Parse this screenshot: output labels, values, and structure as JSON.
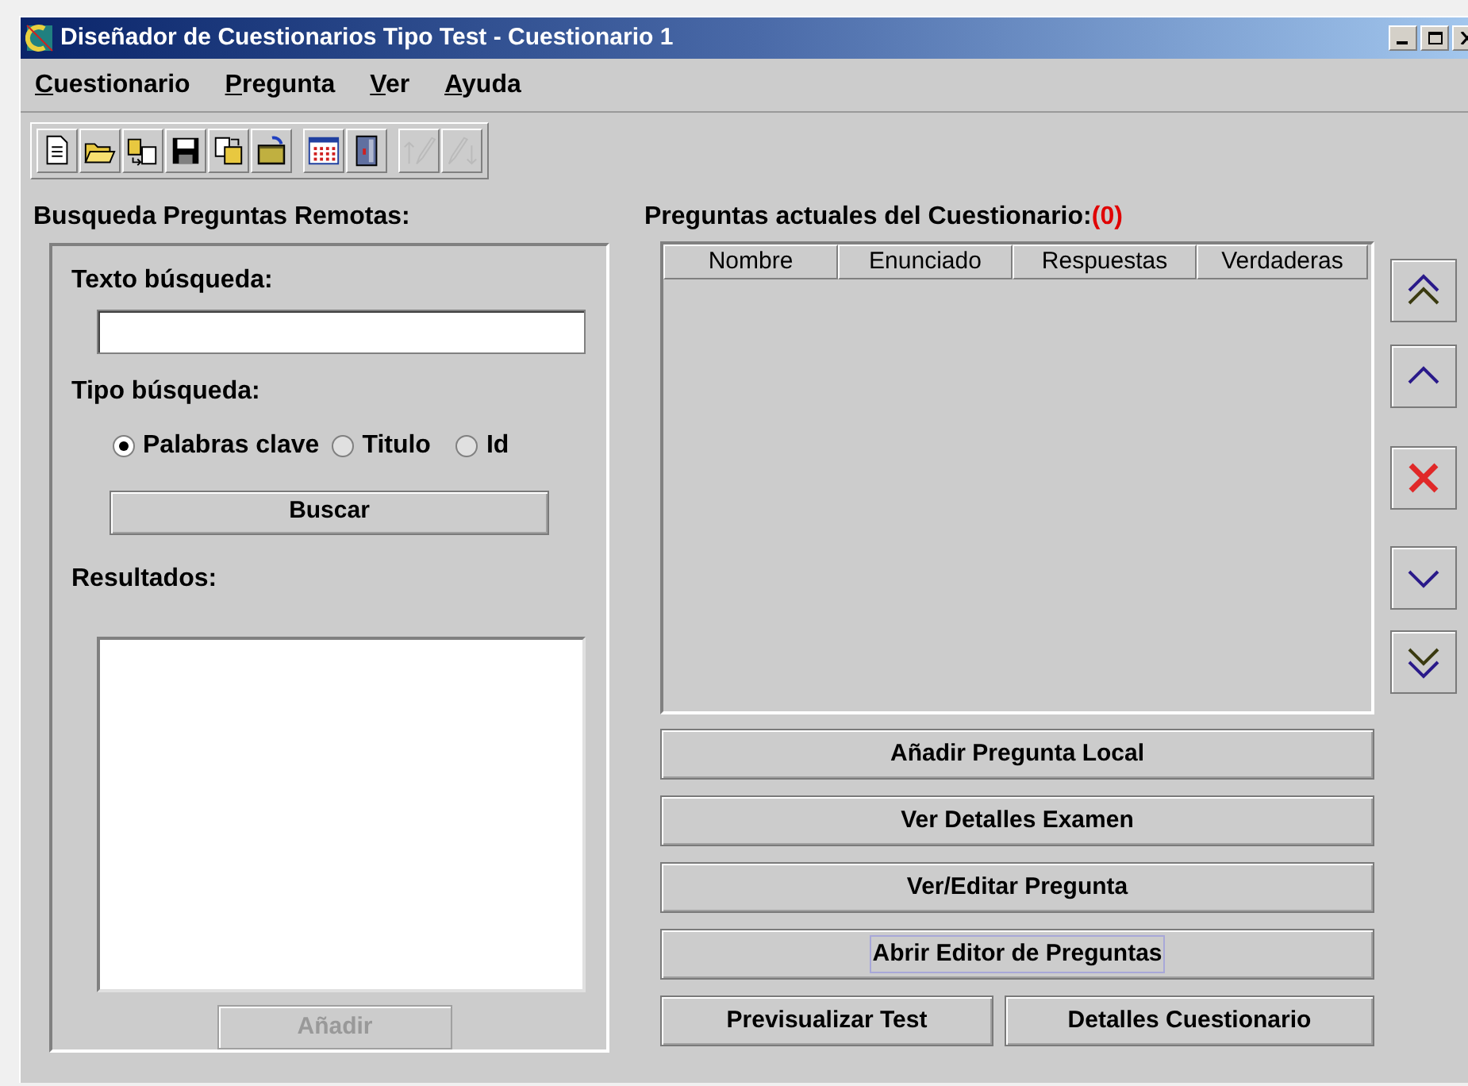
{
  "window": {
    "title": "Diseñador de Cuestionarios Tipo Test - Cuestionario 1"
  },
  "menu": [
    {
      "label": "Cuestionario"
    },
    {
      "label": "Pregunta"
    },
    {
      "label": "Ver"
    },
    {
      "label": "Ayuda"
    }
  ],
  "toolbar": [
    {
      "kind": "new",
      "disabled": false
    },
    {
      "kind": "open",
      "disabled": false
    },
    {
      "kind": "import",
      "disabled": false
    },
    {
      "kind": "save",
      "disabled": false
    },
    {
      "kind": "export",
      "disabled": false
    },
    {
      "kind": "folder",
      "disabled": false
    },
    {
      "kind": "calendar",
      "disabled": false
    },
    {
      "kind": "cabinet",
      "disabled": false
    },
    {
      "kind": "upload",
      "disabled": true
    },
    {
      "kind": "download",
      "disabled": true
    }
  ],
  "remote_search": {
    "title": "Busqueda Preguntas Remotas:",
    "text_label": "Texto búsqueda:",
    "type_label": "Tipo búsqueda:",
    "options": [
      {
        "label": "Palabras clave",
        "selected": true
      },
      {
        "label": "Titulo",
        "selected": false
      },
      {
        "label": "Id",
        "selected": false
      }
    ],
    "search_button": "Buscar",
    "results_label": "Resultados:",
    "add_button": {
      "label": "Añadir",
      "disabled": true
    }
  },
  "current_questions": {
    "title": "Preguntas actuales del Cuestionario:",
    "count": "(0)",
    "columns": [
      "Nombre",
      "Enunciado",
      "Respuestas",
      "Verdaderas"
    ],
    "side_buttons": [
      {
        "kind": "top"
      },
      {
        "kind": "up"
      },
      {
        "kind": "delete"
      },
      {
        "kind": "down"
      },
      {
        "kind": "bottom"
      }
    ],
    "buttons": [
      {
        "label": "Añadir Pregunta Local",
        "focused": false
      },
      {
        "label": "Ver Detalles Examen",
        "focused": false
      },
      {
        "label": "Ver/Editar Pregunta",
        "focused": false
      },
      {
        "label": "Abrir Editor de Preguntas",
        "focused": true
      }
    ],
    "bottom_buttons": [
      {
        "label": "Previsualizar Test"
      },
      {
        "label": "Detalles Cuestionario"
      }
    ]
  }
}
